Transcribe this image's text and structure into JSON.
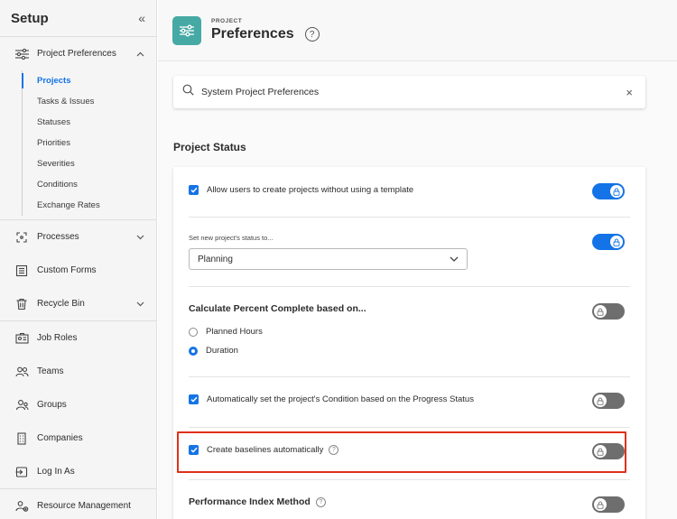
{
  "sidebar": {
    "title": "Setup",
    "collapse_icon": "«",
    "items": [
      {
        "label": "Project Preferences",
        "icon": "sliders-icon"
      },
      {
        "label": "Processes",
        "icon": "processes-icon"
      },
      {
        "label": "Custom Forms",
        "icon": "forms-icon"
      },
      {
        "label": "Recycle Bin",
        "icon": "trash-icon"
      },
      {
        "label": "Job Roles",
        "icon": "job-roles-icon"
      },
      {
        "label": "Teams",
        "icon": "teams-icon"
      },
      {
        "label": "Groups",
        "icon": "groups-icon"
      },
      {
        "label": "Companies",
        "icon": "companies-icon"
      },
      {
        "label": "Log In As",
        "icon": "login-icon"
      },
      {
        "label": "Resource Management",
        "icon": "resource-icon"
      }
    ],
    "subitems": [
      "Projects",
      "Tasks & Issues",
      "Statuses",
      "Priorities",
      "Severities",
      "Conditions",
      "Exchange Rates"
    ]
  },
  "header": {
    "kicker": "PROJECT",
    "title": "Preferences",
    "help": "?"
  },
  "search": {
    "value": "System Project Preferences",
    "clear": "×"
  },
  "section": {
    "title": "Project Status"
  },
  "settings": {
    "allow_without_template": "Allow users to create projects without using a template",
    "status_label": "Set new project's status to...",
    "status_value": "Planning",
    "percent_title": "Calculate Percent Complete based on...",
    "planned_hours": "Planned Hours",
    "duration": "Duration",
    "auto_condition": "Automatically set the project's Condition based on the Progress Status",
    "baselines": "Create baselines automatically",
    "performance": "Performance Index Method",
    "q": "?"
  },
  "colors": {
    "accent": "#1473e6",
    "tile": "#46a9a4",
    "highlight": "#e03018"
  }
}
